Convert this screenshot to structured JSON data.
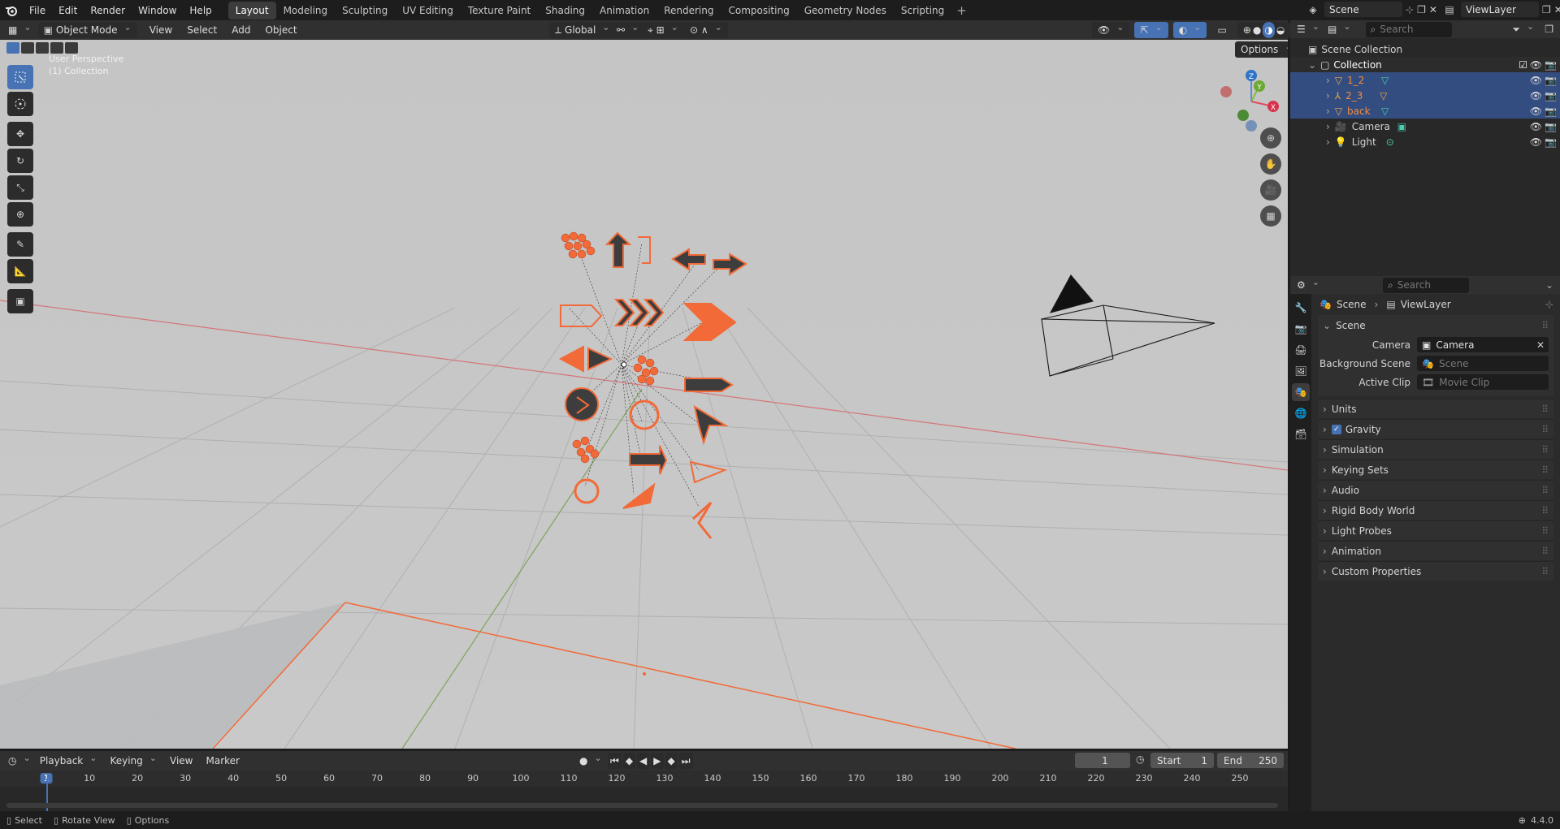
{
  "menu": {
    "file": "File",
    "edit": "Edit",
    "render": "Render",
    "window": "Window",
    "help": "Help"
  },
  "workspaces": [
    "Layout",
    "Modeling",
    "Sculpting",
    "UV Editing",
    "Texture Paint",
    "Shading",
    "Animation",
    "Rendering",
    "Compositing",
    "Geometry Nodes",
    "Scripting"
  ],
  "topright": {
    "scene": "Scene",
    "viewlayer": "ViewLayer"
  },
  "viewport_header": {
    "mode": "Object Mode",
    "view": "View",
    "select": "Select",
    "add": "Add",
    "object": "Object",
    "orientation": "Global",
    "options": "Options"
  },
  "viewport": {
    "perspective": "User Perspective",
    "collection": "(1) Collection"
  },
  "gizmo": {
    "z": "Z",
    "y": "Y",
    "x": "X"
  },
  "outliner": {
    "search_placeholder": "Search",
    "scene_collection": "Scene Collection",
    "collection": "Collection",
    "items": [
      {
        "name": "1_2",
        "selected": true
      },
      {
        "name": "2_3",
        "selected": true
      },
      {
        "name": "back",
        "selected": true
      },
      {
        "name": "Camera",
        "selected": false
      },
      {
        "name": "Light",
        "selected": false
      }
    ]
  },
  "properties": {
    "search_placeholder": "Search",
    "breadcrumb_scene": "Scene",
    "breadcrumb_viewlayer": "ViewLayer",
    "panel_scene": "Scene",
    "camera_label": "Camera",
    "camera_value": "Camera",
    "bg_scene_label": "Background Scene",
    "bg_scene_value": "Scene",
    "active_clip_label": "Active Clip",
    "active_clip_value": "Movie Clip",
    "panels": [
      "Units",
      "Gravity",
      "Simulation",
      "Keying Sets",
      "Audio",
      "Rigid Body World",
      "Light Probes",
      "Animation",
      "Custom Properties"
    ]
  },
  "timeline": {
    "playback": "Playback",
    "keying": "Keying",
    "view": "View",
    "marker": "Marker",
    "current_frame": "1",
    "start_label": "Start",
    "start_value": "1",
    "end_label": "End",
    "end_value": "250",
    "ruler": [
      "1",
      "10",
      "20",
      "30",
      "40",
      "50",
      "60",
      "70",
      "80",
      "90",
      "100",
      "110",
      "120",
      "130",
      "140",
      "150",
      "160",
      "170",
      "180",
      "190",
      "200",
      "210",
      "220",
      "230",
      "240",
      "250"
    ]
  },
  "statusbar": {
    "select": "Select",
    "rotate": "Rotate View",
    "options": "Options",
    "version": "4.4.0"
  },
  "colors": {
    "accent": "#4772b3",
    "selection": "#334d80",
    "orange": "#f26a38",
    "viewport_bg": "#c6c6c6"
  }
}
